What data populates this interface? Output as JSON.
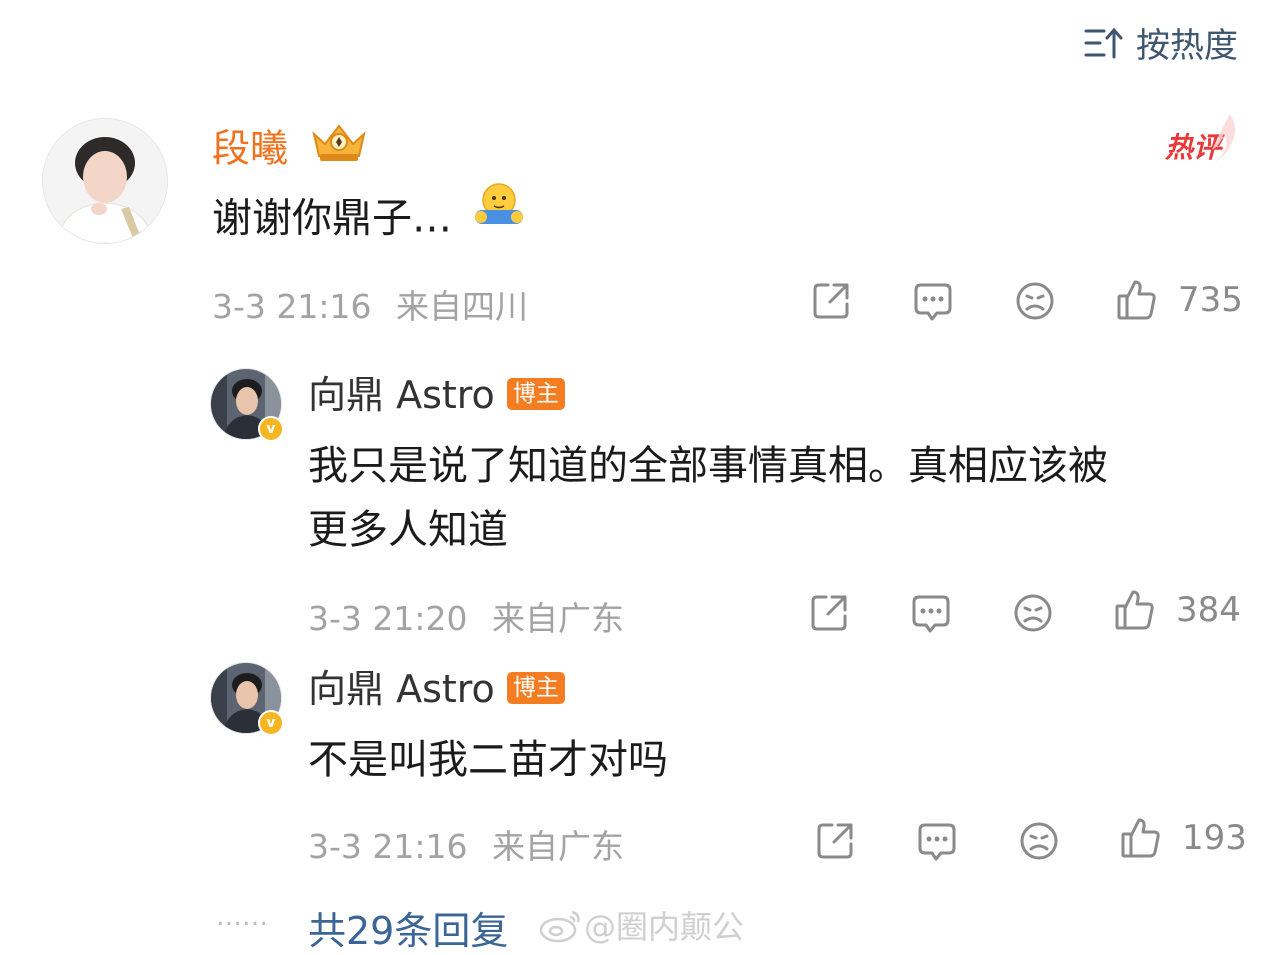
{
  "sort": {
    "label": "按热度",
    "icon": "sort-icon"
  },
  "colors": {
    "username": "#f2711c",
    "badge": "#f47d22",
    "link": "#3a6596",
    "hot": "#e83a3a",
    "verified": "#f5b61f"
  },
  "comment": {
    "username": "段曦",
    "crown_icon": "crown-icon",
    "hot_label": "热评",
    "text": "谢谢你鼎子…",
    "emoji": "hug-emoji",
    "time": "3-3 21:16",
    "location": "来自四川",
    "likes": "735"
  },
  "replies": [
    {
      "username": "向鼎 Astro",
      "badge": "博主",
      "verified": "v",
      "text_line1": "我只是说了知道的全部事情真相。真相应该被",
      "text_line2": "更多人知道",
      "time": "3-3 21:20",
      "location": "来自广东",
      "likes": "384"
    },
    {
      "username": "向鼎 Astro",
      "badge": "博主",
      "verified": "v",
      "text_line1": "不是叫我二苗才对吗",
      "time": "3-3 21:16",
      "location": "来自广东",
      "likes": "193"
    }
  ],
  "footer": {
    "dots": "……",
    "more_replies": "共29条回复",
    "watermark": "@圈内颠公"
  }
}
